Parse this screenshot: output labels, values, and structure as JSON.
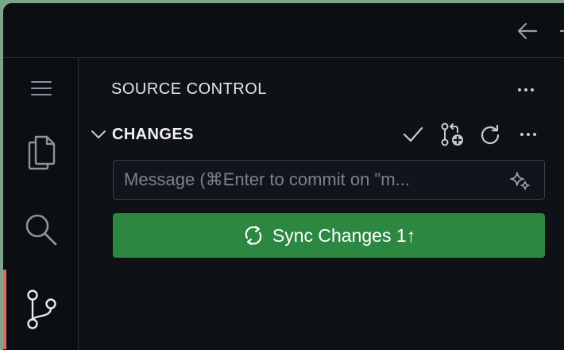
{
  "sidebar": {
    "title": "SOURCE CONTROL",
    "section_title": "CHANGES",
    "message_placeholder": "Message (⌘Enter to commit on \"m...",
    "sync_button_label": "Sync Changes 1↑"
  },
  "activity_bar": {
    "items": [
      "menu-icon",
      "explorer-icon",
      "search-icon",
      "source-control-icon"
    ],
    "active": "source-control-icon"
  },
  "colors": {
    "accent_active": "#e06d5d",
    "sync_button": "#2c8741",
    "background": "#0e1116"
  }
}
